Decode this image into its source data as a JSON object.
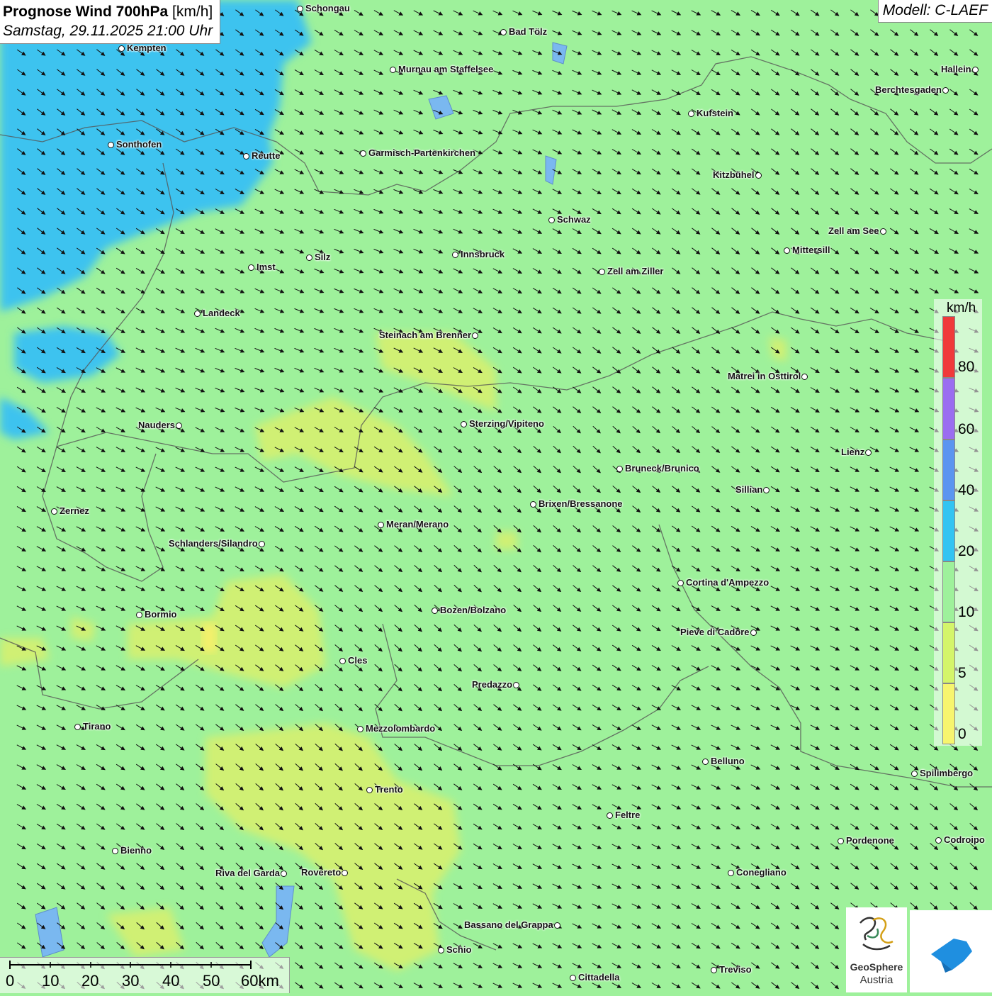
{
  "title": {
    "main": "Prognose Wind 700hPa",
    "unit": "[km/h]",
    "datetime": "Samstag, 29.11.2025 21:00 Uhr"
  },
  "model": "Modell: C-LAEF",
  "legend": {
    "unit": "km/h",
    "ticks": [
      "80",
      "60",
      "40",
      "20",
      "10",
      "5",
      "0"
    ],
    "colors": [
      "#f03a3a",
      "#9a6df0",
      "#5b95f0",
      "#32c4f2",
      "#9ef19b",
      "#d4f56a",
      "#f7f56e"
    ]
  },
  "scale": {
    "labels": [
      "0",
      "10",
      "20",
      "30",
      "40",
      "50",
      "60km"
    ]
  },
  "logos": {
    "geosphere_line1": "GeoSphere",
    "geosphere_line2": "Austria"
  },
  "cities": [
    {
      "name": "Schongau"
    },
    {
      "name": "Bad Tölz"
    },
    {
      "name": "Kempten"
    },
    {
      "name": "Murnau am Staffelsee"
    },
    {
      "name": "Hallein"
    },
    {
      "name": "Berchtesgaden"
    },
    {
      "name": "Kufstein"
    },
    {
      "name": "Sonthofen"
    },
    {
      "name": "Reutte"
    },
    {
      "name": "Garmisch-Partenkirchen"
    },
    {
      "name": "Kitzbühel"
    },
    {
      "name": "Schwaz"
    },
    {
      "name": "Zell am See"
    },
    {
      "name": "Innsbruck"
    },
    {
      "name": "Mittersill"
    },
    {
      "name": "Silz"
    },
    {
      "name": "Imst"
    },
    {
      "name": "Zell am Ziller"
    },
    {
      "name": "Landeck"
    },
    {
      "name": "Steinach am Brenner"
    },
    {
      "name": "Matrei in Osttirol"
    },
    {
      "name": "Nauders"
    },
    {
      "name": "Sterzing/Vipiteno"
    },
    {
      "name": "Lienz"
    },
    {
      "name": "Bruneck/Brunico"
    },
    {
      "name": "Sillian"
    },
    {
      "name": "Zernez"
    },
    {
      "name": "Brixen/Bressanone"
    },
    {
      "name": "Meran/Merano"
    },
    {
      "name": "Schlanders/Silandro"
    },
    {
      "name": "Cortina d'Ampezzo"
    },
    {
      "name": "Bozen/Bolzano"
    },
    {
      "name": "Bormio"
    },
    {
      "name": "Pieve di Cadore"
    },
    {
      "name": "Cles"
    },
    {
      "name": "Predazzo"
    },
    {
      "name": "Tirano"
    },
    {
      "name": "Mezzolombardo"
    },
    {
      "name": "Belluno"
    },
    {
      "name": "Spilimbergo"
    },
    {
      "name": "Trento"
    },
    {
      "name": "Feltre"
    },
    {
      "name": "Pordenone"
    },
    {
      "name": "Codroipo"
    },
    {
      "name": "Bienno"
    },
    {
      "name": "Riva del Garda"
    },
    {
      "name": "Rovereto"
    },
    {
      "name": "Conegliano"
    },
    {
      "name": "Bassano del Grappa"
    },
    {
      "name": "Schio"
    },
    {
      "name": "Treviso"
    },
    {
      "name": "Cittadella"
    }
  ]
}
